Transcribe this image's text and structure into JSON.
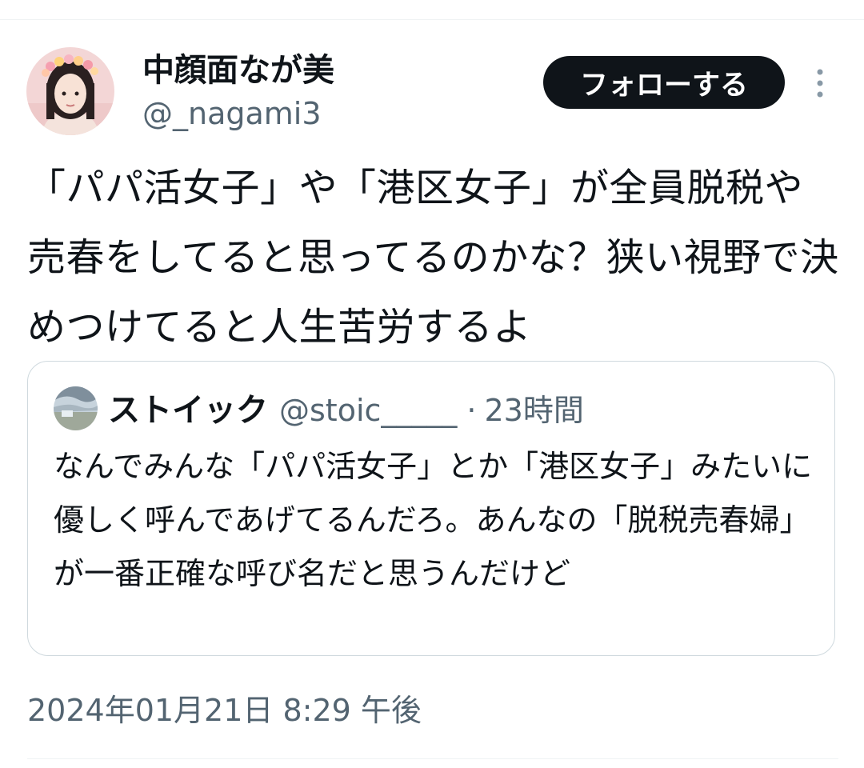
{
  "tweet": {
    "author": {
      "display_name": "中顔面なが美",
      "handle": "@_nagami3",
      "avatar_icon": "user-avatar-photo"
    },
    "follow_label": "フォローする",
    "more_icon": "more-vertical-icon",
    "text": "「パパ活女子」や「港区女子」が全員脱税や売春をしてると思ってるのかな？狭い視野で決めつけてると人生苦労するよ",
    "timestamp": "2024年01月21日 8:29 午後"
  },
  "quote": {
    "display_name": "ストイック",
    "handle": "@stoic_____",
    "separator": "·",
    "relative_time": "23時間",
    "avatar_icon": "landscape-avatar",
    "text": "なんでみんな「パパ活女子」とか「港区女子」みたいに優しく呼んであげてるんだろ。あんなの「脱税売春婦」が一番正確な呼び名だと思うんだけど"
  },
  "colors": {
    "text_primary": "#0f1419",
    "text_secondary": "#536471",
    "border": "#cfd9de",
    "button_bg": "#0f1419",
    "button_text": "#ffffff"
  }
}
